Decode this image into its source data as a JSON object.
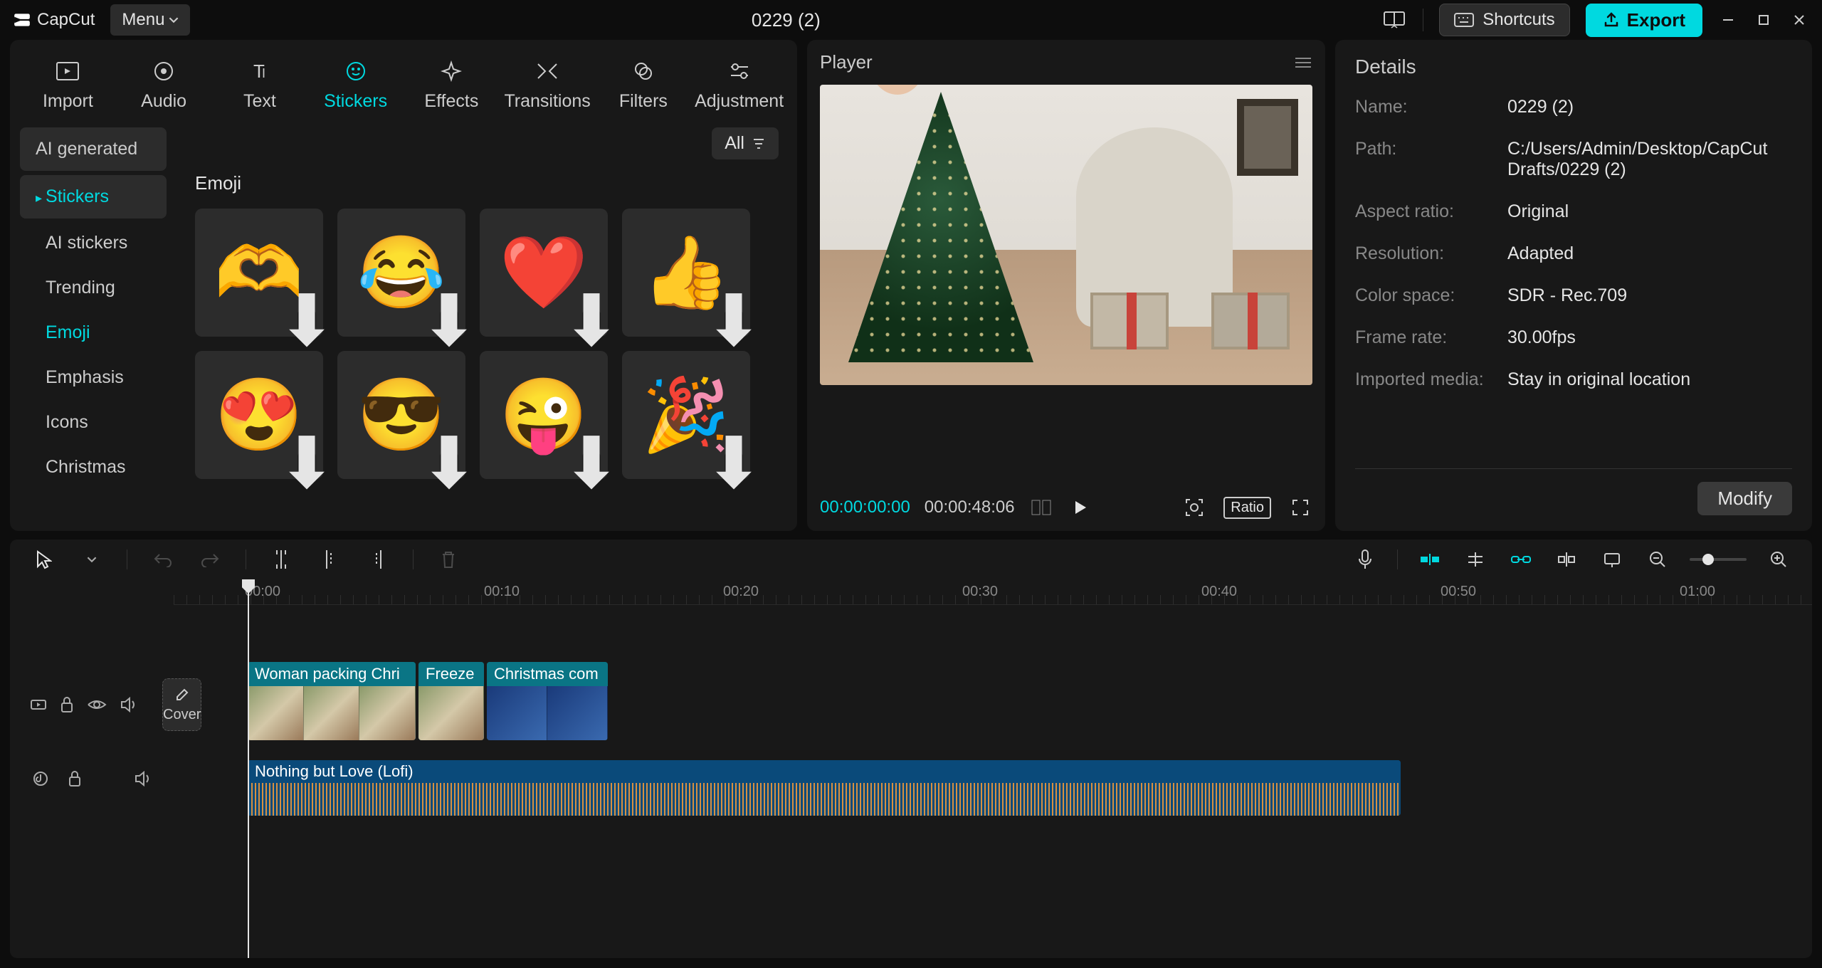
{
  "app": {
    "name": "CapCut",
    "menu_label": "Menu"
  },
  "project": {
    "title": "0229 (2)"
  },
  "titlebar": {
    "shortcuts_label": "Shortcuts",
    "export_label": "Export"
  },
  "media": {
    "tabs": [
      {
        "label": "Import"
      },
      {
        "label": "Audio"
      },
      {
        "label": "Text"
      },
      {
        "label": "Stickers"
      },
      {
        "label": "Effects"
      },
      {
        "label": "Transitions"
      },
      {
        "label": "Filters"
      },
      {
        "label": "Adjustment"
      }
    ],
    "sidebar": {
      "ai_generated": "AI generated",
      "stickers": "Stickers",
      "subs": [
        "AI stickers",
        "Trending",
        "Emoji",
        "Emphasis",
        "Icons",
        "Christmas"
      ]
    },
    "filter_all": "All",
    "section_title": "Emoji",
    "stickers_row1": [
      "🫶",
      "😂",
      "❤️",
      "👍"
    ],
    "stickers_row2": [
      "😍",
      "😎",
      "😜",
      "🎉"
    ]
  },
  "player": {
    "title": "Player",
    "current_time": "00:00:00:00",
    "duration": "00:00:48:06",
    "ratio_label": "Ratio"
  },
  "details": {
    "title": "Details",
    "rows": [
      {
        "label": "Name:",
        "value": "0229 (2)"
      },
      {
        "label": "Path:",
        "value": "C:/Users/Admin/Desktop/CapCut Drafts/0229 (2)"
      },
      {
        "label": "Aspect ratio:",
        "value": "Original"
      },
      {
        "label": "Resolution:",
        "value": "Adapted"
      },
      {
        "label": "Color space:",
        "value": "SDR - Rec.709"
      },
      {
        "label": "Frame rate:",
        "value": "30.00fps"
      },
      {
        "label": "Imported media:",
        "value": "Stay in original location"
      }
    ],
    "modify_label": "Modify"
  },
  "timeline": {
    "cover_label": "Cover",
    "ruler": [
      "00:00",
      "00:10",
      "00:20",
      "00:30",
      "00:40",
      "00:50",
      "01:00"
    ],
    "clips": [
      {
        "label": "Woman packing Chri"
      },
      {
        "label": "Freeze"
      },
      {
        "label": "Christmas com"
      }
    ],
    "audio": {
      "label": "Nothing but Love (Lofi)"
    }
  }
}
